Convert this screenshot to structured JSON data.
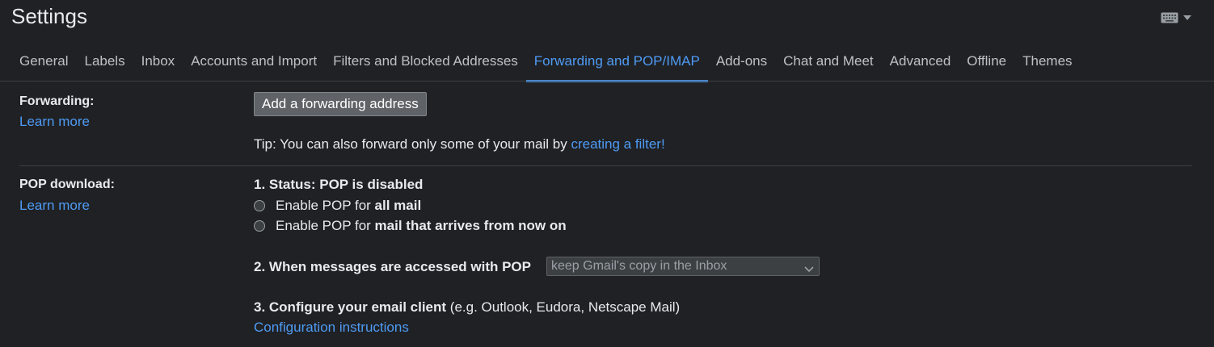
{
  "page_title": "Settings",
  "toolbar": {
    "keyboard_icon": "keyboard-icon",
    "dropdown_icon": "caret-down-icon"
  },
  "tabs": [
    {
      "label": "General",
      "active": false
    },
    {
      "label": "Labels",
      "active": false
    },
    {
      "label": "Inbox",
      "active": false
    },
    {
      "label": "Accounts and Import",
      "active": false
    },
    {
      "label": "Filters and Blocked Addresses",
      "active": false
    },
    {
      "label": "Forwarding and POP/IMAP",
      "active": true
    },
    {
      "label": "Add-ons",
      "active": false
    },
    {
      "label": "Chat and Meet",
      "active": false
    },
    {
      "label": "Advanced",
      "active": false
    },
    {
      "label": "Offline",
      "active": false
    },
    {
      "label": "Themes",
      "active": false
    }
  ],
  "forwarding": {
    "label": "Forwarding:",
    "learn_more": "Learn more",
    "add_button": "Add a forwarding address",
    "tip_prefix": "Tip: You can also forward only some of your mail by ",
    "tip_link": "creating a filter!"
  },
  "pop": {
    "label": "POP download:",
    "learn_more": "Learn more",
    "status": "1. Status: POP is disabled",
    "option_all_prefix": "Enable POP for ",
    "option_all_bold": "all mail",
    "option_now_prefix": "Enable POP for ",
    "option_now_bold": "mail that arrives from now on",
    "access_label": "2. When messages are accessed with POP",
    "access_select_value": "keep Gmail's copy in the Inbox",
    "client_label_bold": "3. Configure your email client",
    "client_label_rest": " (e.g. Outlook, Eudora, Netscape Mail)",
    "config_link": "Configuration instructions"
  },
  "colors": {
    "background": "#202124",
    "accent": "#4e9bf5",
    "text": "#e8eaed"
  }
}
